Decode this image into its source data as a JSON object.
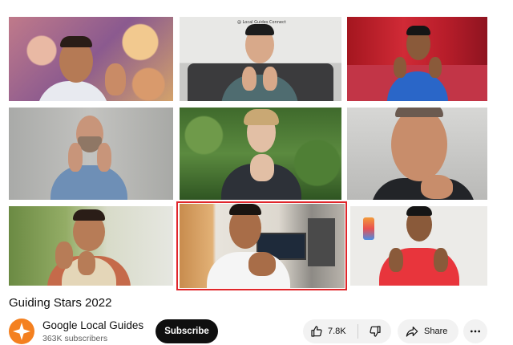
{
  "video": {
    "participants": [
      {
        "id": "p1",
        "tile_label": ""
      },
      {
        "id": "p2",
        "tile_label": "@ Local Guides Connect"
      },
      {
        "id": "p3",
        "tile_label": ""
      },
      {
        "id": "p4",
        "tile_label": ""
      },
      {
        "id": "p5",
        "tile_label": ""
      },
      {
        "id": "p6",
        "tile_label": ""
      },
      {
        "id": "p7",
        "tile_label": ""
      },
      {
        "id": "p8",
        "tile_label": ""
      },
      {
        "id": "p9",
        "tile_label": ""
      }
    ],
    "highlighted_tile": "p8",
    "highlight_color": "#e0262b"
  },
  "title": "Guiding Stars 2022",
  "channel": {
    "name": "Google Local Guides",
    "subscribers": "363K subscribers",
    "avatar_icon": "local-guides-star-icon",
    "avatar_color": "#f4801f"
  },
  "actions": {
    "subscribe_label": "Subscribe",
    "like_count": "7.8K",
    "like_icon": "thumbs-up-icon",
    "dislike_icon": "thumbs-down-icon",
    "share_label": "Share",
    "share_icon": "share-arrow-icon",
    "more_icon": "more-horizontal-icon"
  }
}
